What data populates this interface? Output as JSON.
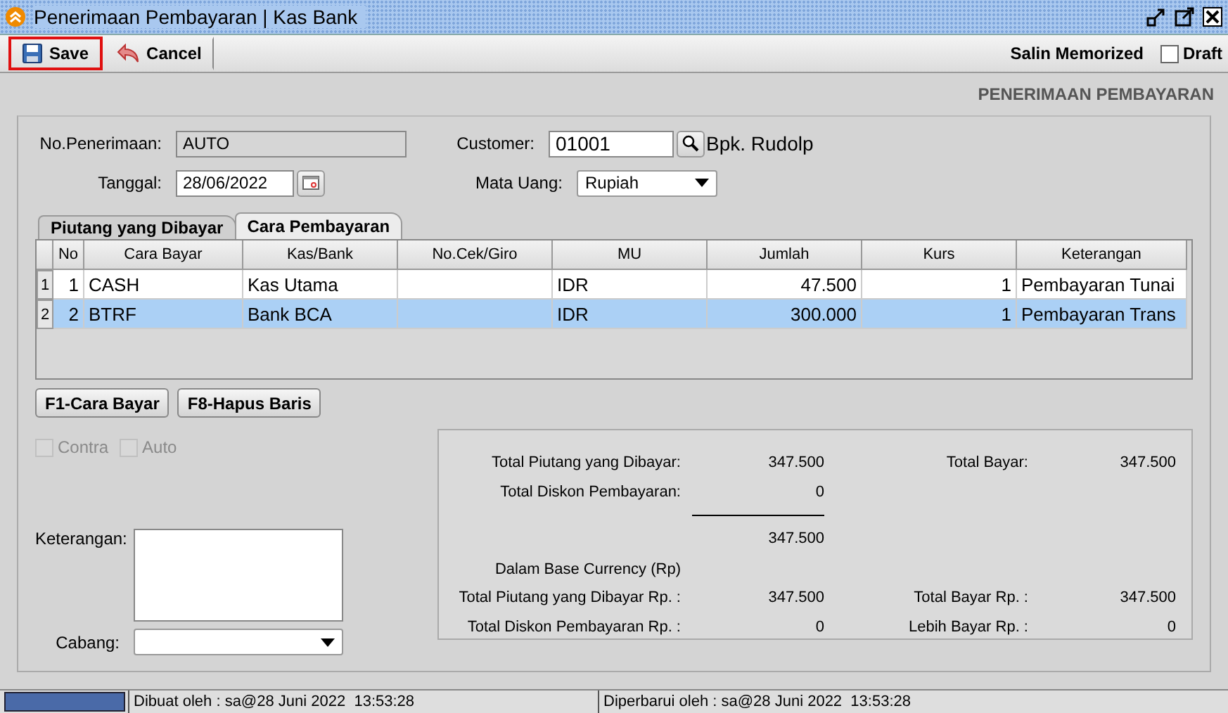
{
  "window": {
    "title": "Penerimaan Pembayaran | Kas Bank"
  },
  "toolbar": {
    "buttons": [
      {
        "label": "Save",
        "focused": true
      },
      {
        "label": "Cancel",
        "focused": false
      }
    ],
    "memorized_label": "Salin Memorized",
    "draft": {
      "label": "Draft",
      "checked": false
    }
  },
  "form_title": "PENERIMAAN PEMBAYARAN",
  "header": {
    "no_penerimaan": {
      "label": "No.Penerimaan:",
      "value": "AUTO"
    },
    "tanggal": {
      "label": "Tanggal:",
      "value": "28/06/2022"
    },
    "customer": {
      "label": "Customer:",
      "value": "01001",
      "name": "Bpk. Rudolp"
    },
    "mata_uang": {
      "label": "Mata Uang:",
      "value": "Rupiah"
    }
  },
  "tabs": [
    {
      "label": "Piutang yang Dibayar",
      "selected": false
    },
    {
      "label": "Cara Pembayaran",
      "selected": true
    }
  ],
  "table": {
    "columns": [
      "No",
      "Cara Bayar",
      "Kas/Bank",
      "No.Cek/Giro",
      "MU",
      "Jumlah",
      "Kurs",
      "Keterangan"
    ],
    "rows": [
      {
        "row_header": "1",
        "selected": false,
        "cells": [
          "1",
          "CASH",
          "Kas Utama",
          null,
          "IDR",
          "47.500",
          "1",
          "Pembayaran Tunai"
        ]
      },
      {
        "row_header": "2",
        "selected": true,
        "cells": [
          "2",
          "BTRF",
          "Bank BCA",
          null,
          "IDR",
          "300.000",
          "1",
          "Pembayaran Trans"
        ]
      }
    ]
  },
  "table_buttons": [
    "F1-Cara Bayar",
    "F8-Hapus Baris"
  ],
  "options": [
    {
      "label": "Contra",
      "checked": false,
      "disabled": true
    },
    {
      "label": "Auto",
      "checked": false,
      "disabled": true
    }
  ],
  "keterangan": {
    "label": "Keterangan:"
  },
  "cabang": {
    "label": "Cabang:"
  },
  "summary": [
    {
      "kind": "pair",
      "label": "Total Piutang yang Dibayar:",
      "value": "347.500",
      "label_2": "Total Bayar:",
      "value_2": "347.500"
    },
    {
      "kind": "pair",
      "label": "Total Diskon Pembayaran:",
      "value": "0"
    },
    {
      "kind": "rule"
    },
    {
      "kind": "pair",
      "value": "347.500"
    },
    {
      "kind": "heading",
      "label": "Dalam Base Currency (Rp)"
    },
    {
      "kind": "pair",
      "label": "Total Piutang yang Dibayar Rp. :",
      "value": "347.500",
      "label_2": "Total Bayar Rp. :",
      "value_2": "347.500"
    },
    {
      "kind": "pair",
      "label": "Total Diskon Pembayaran Rp. :",
      "value": "0",
      "label_2": "Lebih Bayar Rp. :",
      "value_2": "0"
    }
  ],
  "status_bar": [
    "Dibuat oleh : sa@28 Juni 2022  13:53:28",
    "Diperbarui oleh : sa@28 Juni 2022  13:53:28"
  ]
}
